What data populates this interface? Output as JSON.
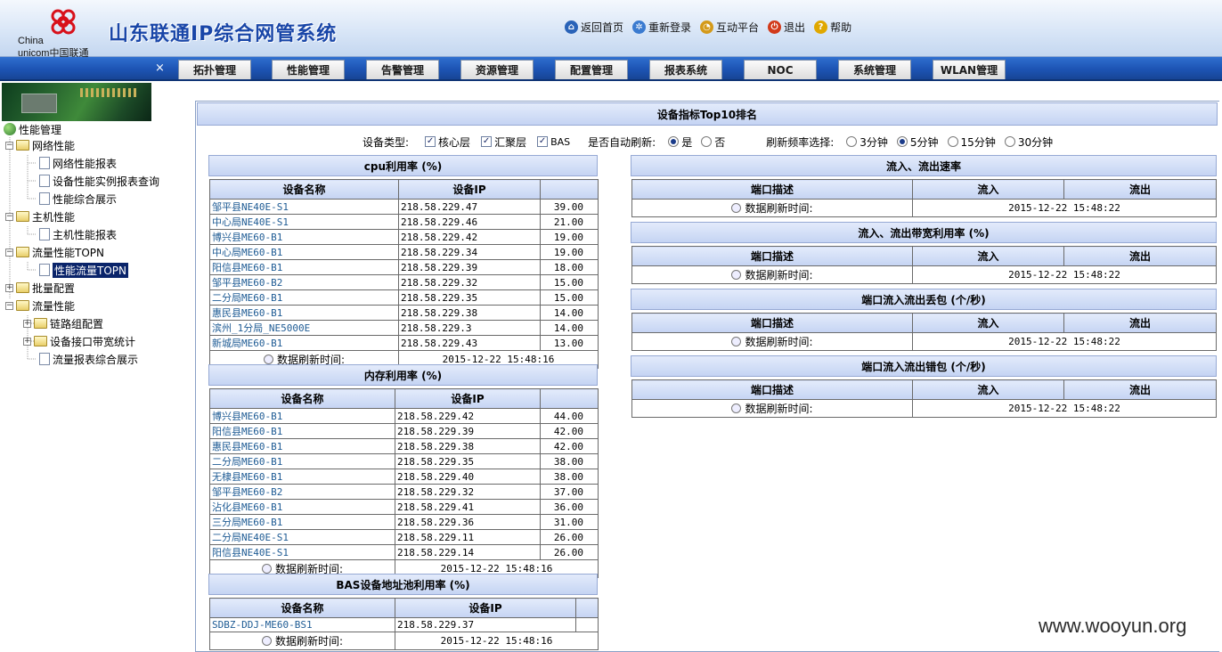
{
  "header": {
    "logo_text_1": "China",
    "logo_text_2": "unicom中国联通",
    "app_title": "山东联通IP综合网管系统",
    "links": [
      {
        "label": "返回首页",
        "icon": "home-icon",
        "color": "#2a63b8"
      },
      {
        "label": "重新登录",
        "icon": "relogin-icon",
        "color": "#3b7bd0"
      },
      {
        "label": "互动平台",
        "icon": "interact-icon",
        "color": "#d49a1a"
      },
      {
        "label": "退出",
        "icon": "power-icon",
        "color": "#d23a1a"
      },
      {
        "label": "帮助",
        "icon": "help-icon",
        "color": "#e0a800"
      }
    ]
  },
  "nav": {
    "close": "×",
    "tabs": [
      "拓扑管理",
      "性能管理",
      "告警管理",
      "资源管理",
      "配置管理",
      "报表系统",
      "NOC",
      "系统管理",
      "WLAN管理"
    ]
  },
  "tree": {
    "root": "性能管理",
    "items": [
      {
        "label": "网络性能"
      },
      {
        "label": "网络性能报表"
      },
      {
        "label": "设备性能实例报表查询"
      },
      {
        "label": "性能综合展示"
      },
      {
        "label": "主机性能"
      },
      {
        "label": "主机性能报表"
      },
      {
        "label": "流量性能TOPN"
      },
      {
        "label": "性能流量TOPN"
      },
      {
        "label": "批量配置"
      },
      {
        "label": "流量性能"
      },
      {
        "label": "链路组配置"
      },
      {
        "label": "设备接口带宽统计"
      },
      {
        "label": "流量报表综合展示"
      }
    ]
  },
  "main": {
    "title": "设备指标Top10排名",
    "filters": {
      "device_type_label": "设备类型:",
      "types": [
        "核心层",
        "汇聚层",
        "BAS"
      ],
      "auto_refresh_label": "是否自动刷新:",
      "yes": "是",
      "no": "否",
      "freq_label": "刷新频率选择:",
      "freqs": [
        "3分钟",
        "5分钟",
        "15分钟",
        "30分钟"
      ],
      "selected_freq": "5分钟"
    },
    "col_name": "设备名称",
    "col_ip": "设备IP",
    "refresh_label": "数据刷新时间:",
    "refresh_time": "2015-12-22 15:48:16",
    "cpu": {
      "title": "cpu利用率 (%)",
      "rows": [
        {
          "name": "邹平县NE40E-S1",
          "ip": "218.58.229.47",
          "value": "39.00"
        },
        {
          "name": "中心局NE40E-S1",
          "ip": "218.58.229.46",
          "value": "21.00"
        },
        {
          "name": "博兴县ME60-B1",
          "ip": "218.58.229.42",
          "value": "19.00"
        },
        {
          "name": "中心局ME60-B1",
          "ip": "218.58.229.34",
          "value": "19.00"
        },
        {
          "name": "阳信县ME60-B1",
          "ip": "218.58.229.39",
          "value": "18.00"
        },
        {
          "name": "邹平县ME60-B2",
          "ip": "218.58.229.32",
          "value": "15.00"
        },
        {
          "name": "二分局ME60-B1",
          "ip": "218.58.229.35",
          "value": "15.00"
        },
        {
          "name": "惠民县ME60-B1",
          "ip": "218.58.229.38",
          "value": "14.00"
        },
        {
          "name": "滨州_1分局_NE5000E",
          "ip": "218.58.229.3",
          "value": "14.00"
        },
        {
          "name": "新城局ME60-B1",
          "ip": "218.58.229.43",
          "value": "13.00"
        }
      ]
    },
    "mem": {
      "title": "内存利用率 (%)",
      "rows": [
        {
          "name": "博兴县ME60-B1",
          "ip": "218.58.229.42",
          "value": "44.00"
        },
        {
          "name": "阳信县ME60-B1",
          "ip": "218.58.229.39",
          "value": "42.00"
        },
        {
          "name": "惠民县ME60-B1",
          "ip": "218.58.229.38",
          "value": "42.00"
        },
        {
          "name": "二分局ME60-B1",
          "ip": "218.58.229.35",
          "value": "38.00"
        },
        {
          "name": "无棣县ME60-B1",
          "ip": "218.58.229.40",
          "value": "38.00"
        },
        {
          "name": "邹平县ME60-B2",
          "ip": "218.58.229.32",
          "value": "37.00"
        },
        {
          "name": "沾化县ME60-B1",
          "ip": "218.58.229.41",
          "value": "36.00"
        },
        {
          "name": "三分局ME60-B1",
          "ip": "218.58.229.36",
          "value": "31.00"
        },
        {
          "name": "二分局NE40E-S1",
          "ip": "218.58.229.11",
          "value": "26.00"
        },
        {
          "name": "阳信县NE40E-S1",
          "ip": "218.58.229.14",
          "value": "26.00"
        }
      ]
    },
    "bas": {
      "title": "BAS设备地址池利用率 (%)",
      "rows": [
        {
          "name": "SDBZ-DDJ-ME60-BS1",
          "ip": "218.58.229.37",
          "value": ""
        }
      ]
    },
    "right": {
      "col_port": "端口描述",
      "col_in": "流入",
      "col_out": "流出",
      "refresh_time": "2015-12-22 15:48:22",
      "sections": [
        {
          "title": "流入、流出速率"
        },
        {
          "title": "流入、流出带宽利用率 (%)"
        },
        {
          "title": "端口流入流出丢包 (个/秒)"
        },
        {
          "title": "端口流入流出错包 (个/秒)"
        }
      ]
    }
  },
  "watermark": "www.wooyun.org"
}
